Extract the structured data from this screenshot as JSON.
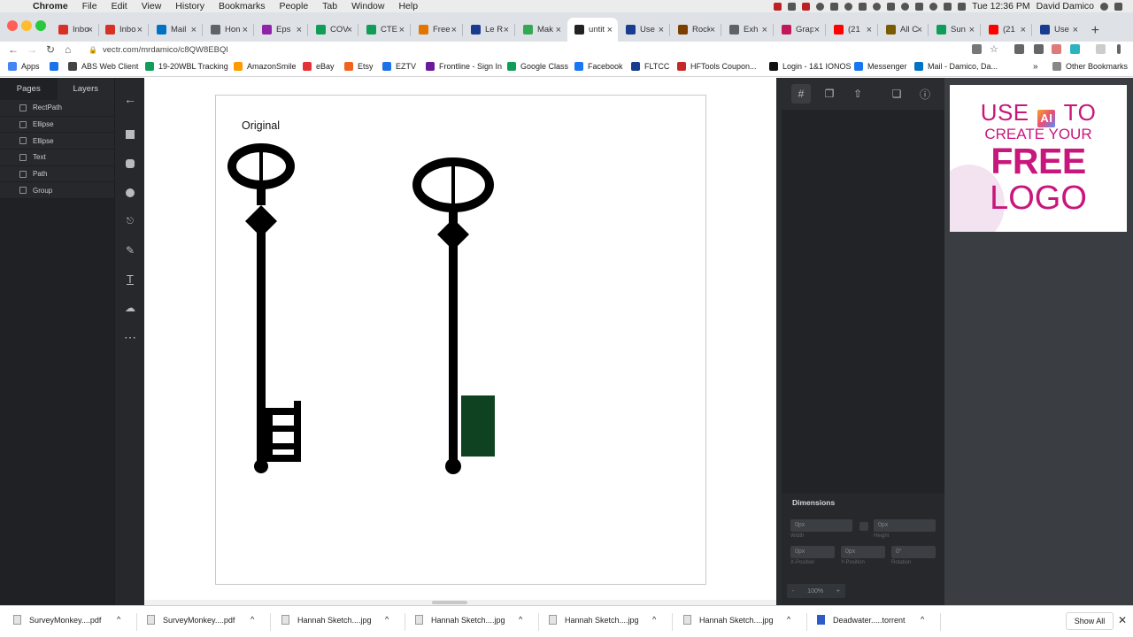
{
  "menubar": {
    "apple": "",
    "app_name": "Chrome",
    "items": [
      "File",
      "Edit",
      "View",
      "History",
      "Bookmarks",
      "People",
      "Tab",
      "Window",
      "Help"
    ],
    "clock": "Tue 12:36 PM",
    "user": "David Damico"
  },
  "tabs": [
    {
      "label": "Inbo",
      "color": "#d93025"
    },
    {
      "label": "Inbo",
      "color": "#d93025"
    },
    {
      "label": "Mail",
      "color": "#0072c6"
    },
    {
      "label": "Hon",
      "color": "#5f6368"
    },
    {
      "label": "Eps",
      "color": "#8e24aa"
    },
    {
      "label": "COV",
      "color": "#0f9d58"
    },
    {
      "label": "CTE",
      "color": "#0f9d58"
    },
    {
      "label": "Free",
      "color": "#e37400"
    },
    {
      "label": "Le R",
      "color": "#1a3c8f"
    },
    {
      "label": "Mak",
      "color": "#34a853"
    },
    {
      "label": "untit",
      "color": "#222222"
    },
    {
      "label": "Use",
      "color": "#1a3c8f"
    },
    {
      "label": "Rock",
      "color": "#7b3f00"
    },
    {
      "label": "Exh",
      "color": "#5f6368"
    },
    {
      "label": "Grap",
      "color": "#c2185b"
    },
    {
      "label": "(21",
      "color": "#ff0000"
    },
    {
      "label": "All C",
      "color": "#7a5c00"
    },
    {
      "label": "Sun",
      "color": "#0f9d58"
    },
    {
      "label": "(21",
      "color": "#ff0000"
    },
    {
      "label": "Use",
      "color": "#1a3c8f"
    }
  ],
  "active_tab_index": 10,
  "address": {
    "url": "vectr.com/mrdamico/c8QW8EBQl"
  },
  "bookmarks": [
    {
      "label": "Apps",
      "color": "#4285f4"
    },
    {
      "label": "",
      "color": "#1a73e8"
    },
    {
      "label": "ABS Web Client",
      "color": "#444444"
    },
    {
      "label": "19-20WBL Tracking",
      "color": "#0f9d58"
    },
    {
      "label": "AmazonSmile",
      "color": "#ff9900"
    },
    {
      "label": "eBay",
      "color": "#e53238"
    },
    {
      "label": "Etsy",
      "color": "#f1641e"
    },
    {
      "label": "EZTV",
      "color": "#1a73e8"
    },
    {
      "label": "Frontline - Sign In",
      "color": "#6a1b9a"
    },
    {
      "label": "Google Class",
      "color": "#0f9d58"
    },
    {
      "label": "Facebook",
      "color": "#1877f2"
    },
    {
      "label": "FLTCC",
      "color": "#1a3c8f"
    },
    {
      "label": "HFTools Coupon...",
      "color": "#c62828"
    },
    {
      "label": "Login - 1&1 IONOS",
      "color": "#111111"
    },
    {
      "label": "Messenger",
      "color": "#1877f2"
    },
    {
      "label": "Mail - Damico, Da...",
      "color": "#0072c6"
    }
  ],
  "other_bookmarks": "Other Bookmarks",
  "panel_tabs": [
    "Pages",
    "Layers"
  ],
  "layers": [
    "RectPath",
    "Ellipse",
    "Ellipse",
    "Text",
    "Path",
    "Group"
  ],
  "tools": [
    "back-arrow",
    "rectangle-tool",
    "rounded-rectangle-tool",
    "ellipse-tool",
    "stamp-tool",
    "pen-tool",
    "text-tool",
    "upload-tool",
    "more-tool"
  ],
  "canvas": {
    "label": "Original",
    "key_fill": "#000000",
    "bit_color": "#0e4221"
  },
  "dimensions": {
    "title": "Dimensions",
    "width_value": "0px",
    "width_label": "Width",
    "height_value": "0px",
    "height_label": "Height",
    "x_value": "0px",
    "x_label": "X-Position",
    "y_value": "0px",
    "y_label": "Y-Position",
    "rotation_value": "0°",
    "rotation_label": "Rotation",
    "zoom": "100%",
    "zoom_minus": "-",
    "zoom_plus": "+"
  },
  "ad": {
    "line1_pre": "USE",
    "line1_badge": "AI",
    "line1_post": "TO",
    "line2": "CREATE YOUR",
    "line3": "FREE",
    "line4": "LOGO",
    "color": "#c8177c"
  },
  "downloads": [
    {
      "name": "SurveyMonkey....pdf"
    },
    {
      "name": "SurveyMonkey....pdf"
    },
    {
      "name": "Hannah Sketch....jpg"
    },
    {
      "name": "Hannah Sketch....jpg"
    },
    {
      "name": "Hannah Sketch....jpg"
    },
    {
      "name": "Hannah Sketch....jpg"
    },
    {
      "name": "Deadwater.....torrent"
    }
  ],
  "show_all": "Show All"
}
